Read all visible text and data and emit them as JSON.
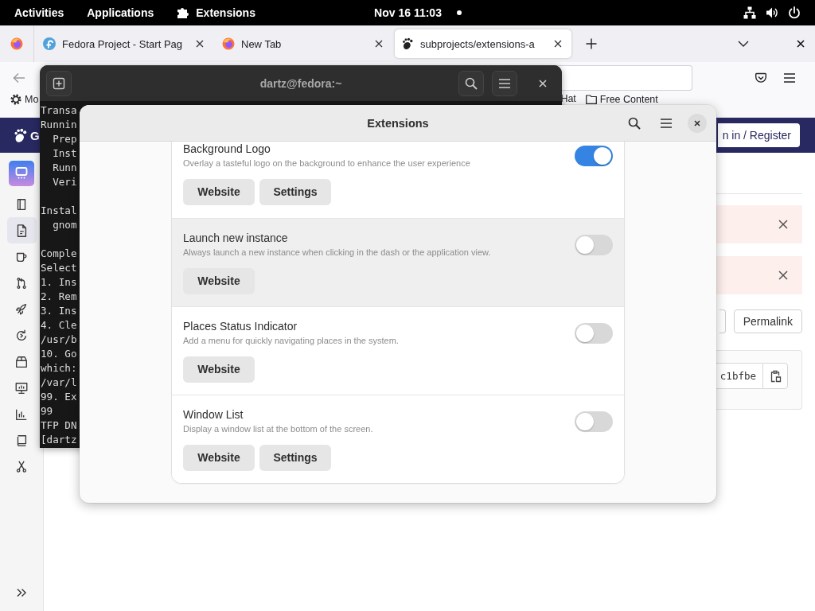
{
  "top_bar": {
    "activities": "Activities",
    "applications": "Applications",
    "app_menu": "Extensions",
    "clock": "Nov 16 11:03"
  },
  "browser": {
    "tabs": [
      {
        "title": "Fedora Project - Start Pag",
        "selected": false
      },
      {
        "title": "New Tab",
        "selected": false
      },
      {
        "title": "subprojects/extensions-a",
        "selected": true
      }
    ],
    "bookmarks": [
      "Mo",
      "Hat",
      "Free Content"
    ],
    "page": {
      "logo_text": "G",
      "sign_in": "n in / Register",
      "sidebar": [
        {
          "selected": false
        },
        {
          "selected": true
        },
        {
          "selected": false
        },
        {
          "selected": false
        },
        {
          "selected": false
        },
        {
          "selected": false
        },
        {
          "selected": false
        },
        {
          "selected": false
        },
        {
          "selected": false
        },
        {
          "selected": false
        },
        {
          "selected": false
        }
      ],
      "alerts": [
        {
          "dismissible": true
        },
        {
          "dismissible": true
        }
      ],
      "permalink": "Permalink",
      "commit_sha": "c1bfbe"
    }
  },
  "terminal": {
    "title": "dartz@fedora:~",
    "blocks": [
      [
        "Transa",
        "Runnin",
        "  Prep",
        "  Inst",
        "  Runn",
        "  Veri"
      ],
      [
        "Instal",
        "  gnom"
      ],
      [
        "Comple",
        "Select",
        "1. Ins",
        "2. Rem",
        "3. Ins",
        "4. Cle",
        "/usr/b",
        "10. Go",
        "which:",
        "/var/l",
        "99. Ex",
        "99",
        "TFP DN",
        "[dartz"
      ]
    ]
  },
  "extensions": {
    "title": "Extensions",
    "rows": [
      {
        "name": "Background Logo",
        "description": "Overlay a tasteful logo on the background to enhance the user experience",
        "enabled": true,
        "hovered": false,
        "buttons": [
          "Website",
          "Settings"
        ]
      },
      {
        "name": "Launch new instance",
        "description": "Always launch a new instance when clicking in the dash or the application view.",
        "enabled": false,
        "hovered": true,
        "buttons": [
          "Website"
        ]
      },
      {
        "name": "Places Status Indicator",
        "description": "Add a menu for quickly navigating places in the system.",
        "enabled": false,
        "hovered": false,
        "buttons": [
          "Website"
        ]
      },
      {
        "name": "Window List",
        "description": "Display a window list at the bottom of the screen.",
        "enabled": false,
        "hovered": false,
        "buttons": [
          "Website",
          "Settings"
        ]
      }
    ]
  }
}
